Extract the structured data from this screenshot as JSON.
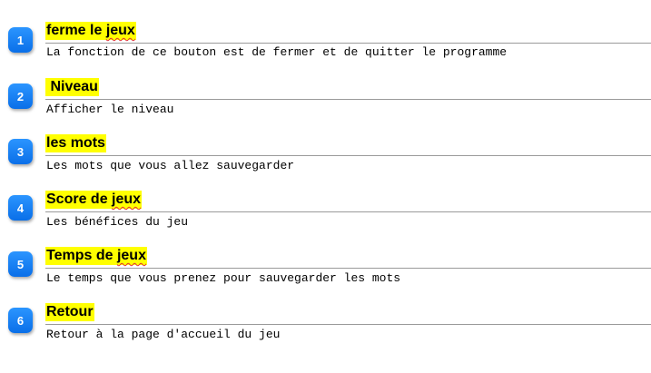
{
  "items": [
    {
      "number": "1",
      "title": "ferme le jeux",
      "squiggle": "jeux",
      "description": "La fonction de ce bouton est de fermer et de quitter le programme"
    },
    {
      "number": "2",
      "title": " Niveau",
      "squiggle": "",
      "description": "Afficher le niveau"
    },
    {
      "number": "3",
      "title": "les mots",
      "squiggle": "",
      "description": "Les mots que vous allez sauvegarder"
    },
    {
      "number": "4",
      "title": "Score de jeux",
      "squiggle": "jeux",
      "description": "Les bénéfices du jeu"
    },
    {
      "number": "5",
      "title": "Temps de jeux",
      "squiggle": "jeux",
      "description": "Le temps que vous prenez pour sauvegarder les mots"
    },
    {
      "number": "6",
      "title": "Retour",
      "squiggle": "",
      "description": "Retour à la page d'accueil du jeu"
    }
  ]
}
